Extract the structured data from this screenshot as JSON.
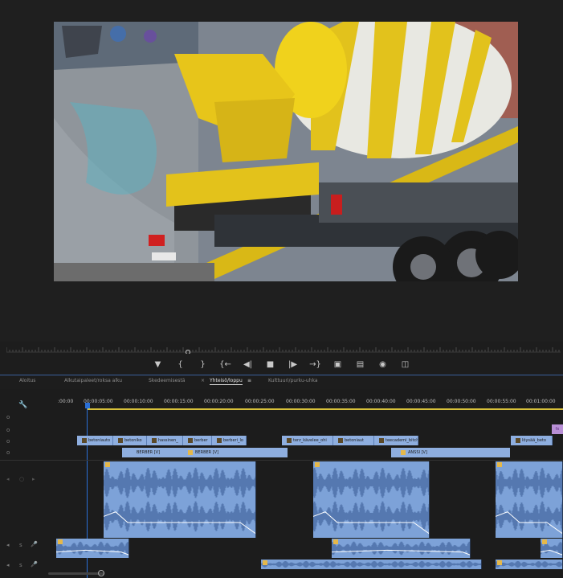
{
  "transport": {
    "buttons": [
      "add-marker",
      "mark-in",
      "mark-out",
      "go-to-in",
      "step-back",
      "stop",
      "step-forward",
      "go-to-out",
      "lift",
      "extract",
      "export-frame",
      "compare"
    ]
  },
  "tabs": [
    {
      "label": "Aloitus"
    },
    {
      "label": "Alkutaipaleet/roksa alku"
    },
    {
      "label": "Skedeemisestä"
    },
    {
      "label": "Yhteisö/loppu",
      "active": true
    },
    {
      "label": "Kulttuuri/purku-uhka"
    }
  ],
  "timeline": {
    "timecodes": [
      ":00:00",
      "00:00:05:00",
      "00:00:10:00",
      "00:00:15:00",
      "00:00:20:00",
      "00:00:25:00",
      "00:00:30:00",
      "00:00:35:00",
      "00:00:40:00",
      "00:00:45:00",
      "00:00:50:00",
      "00:00:55:00",
      "00:01:00:00"
    ],
    "upper_clips": [
      "betoniauto",
      "betoniko",
      "hassinen_",
      "berber",
      "berberi_lo",
      "terz_kävelee_ohi",
      "betoniaut",
      "teecademi_bitch",
      "löysää_beto"
    ],
    "v1_clips": [
      "BERBER [V]",
      "BERBER [V]",
      "ANSSI [V]"
    ],
    "fx_label": "fx"
  },
  "colors": {
    "clip": "#8eaedf",
    "fx": "#e5b84a",
    "playhead": "#2a6fd6",
    "workarea": "#d8c13a"
  }
}
